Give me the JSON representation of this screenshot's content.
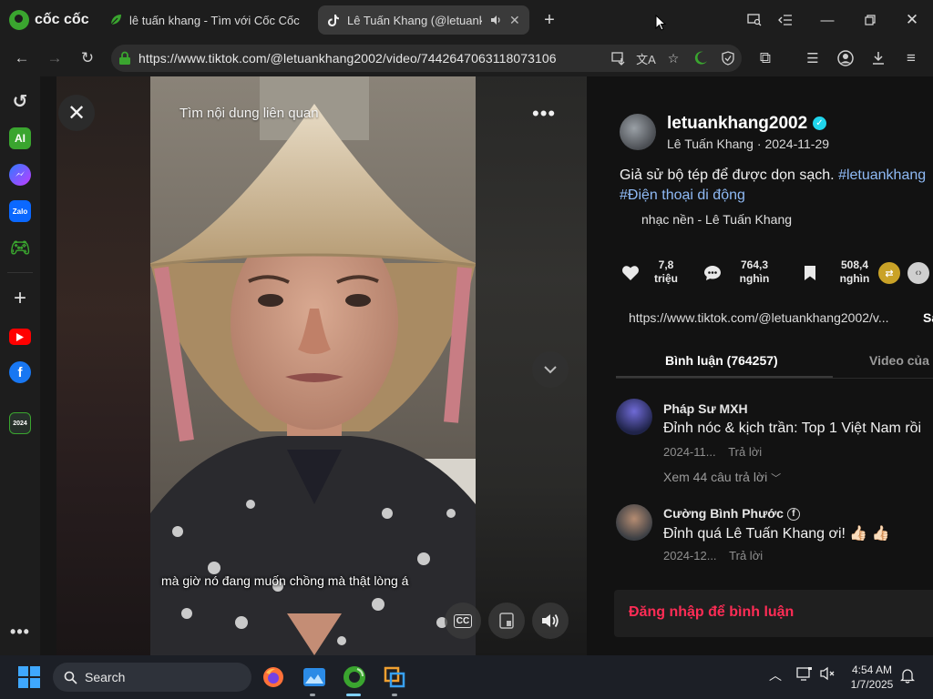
{
  "browser": {
    "logo_text": "cốc cốc",
    "tabs": [
      {
        "title": "lê tuấn khang - Tìm với Cốc Cốc",
        "active": false
      },
      {
        "title": "Lê Tuấn Khang (@letuank",
        "active": true
      }
    ],
    "url": "https://www.tiktok.com/@letuankhang2002/video/7442647063118073106"
  },
  "video": {
    "search_hint": "Tìm nội dung liên quan",
    "caption": "mà giờ nó đang muốn chồng mà thật lòng á"
  },
  "post": {
    "username": "letuankhang2002",
    "display_name": "Lê Tuấn Khang",
    "date": "2024-11-29",
    "description_text": "Giả sử bộ tép để được dọn sạch.",
    "hashtag_1": "#letuankhang",
    "hashtag_2": "#Điện thoại di động",
    "music": "nhạc nền - Lê Tuấn Khang",
    "stats": {
      "likes_value": "7,8",
      "likes_unit": "triệu",
      "comments_value": "764,3",
      "comments_unit": "nghìn",
      "saves_value": "508,4",
      "saves_unit": "nghìn"
    },
    "copy_link_url": "https://www.tiktok.com/@letuankhang2002/v...",
    "copy_link_button": "Sa"
  },
  "tabs": {
    "comments": "Bình luận (764257)",
    "videos": "Video của n"
  },
  "comments": [
    {
      "name": "Pháp Sư MXH",
      "text": "Đỉnh nóc & kịch trần: Top 1 Việt Nam rồi",
      "date": "2024-11...",
      "reply": "Trả lời",
      "more": "Xem 44 câu trả lời"
    },
    {
      "name": "Cường Bình Phước",
      "text": "Đỉnh quá Lê Tuấn Khang ơi! 👍🏻 👍🏻",
      "date": "2024-12...",
      "reply": "Trả lời"
    }
  ],
  "login_prompt": "Đăng nhập để bình luận",
  "taskbar": {
    "search_label": "Search",
    "time": "4:54 AM",
    "date": "1/7/2025"
  },
  "colors": {
    "accent_red": "#fe2c55",
    "hashtag_blue": "#8fbaf5",
    "verified": "#20d5ec",
    "coccoc_green": "#3aa52f"
  }
}
